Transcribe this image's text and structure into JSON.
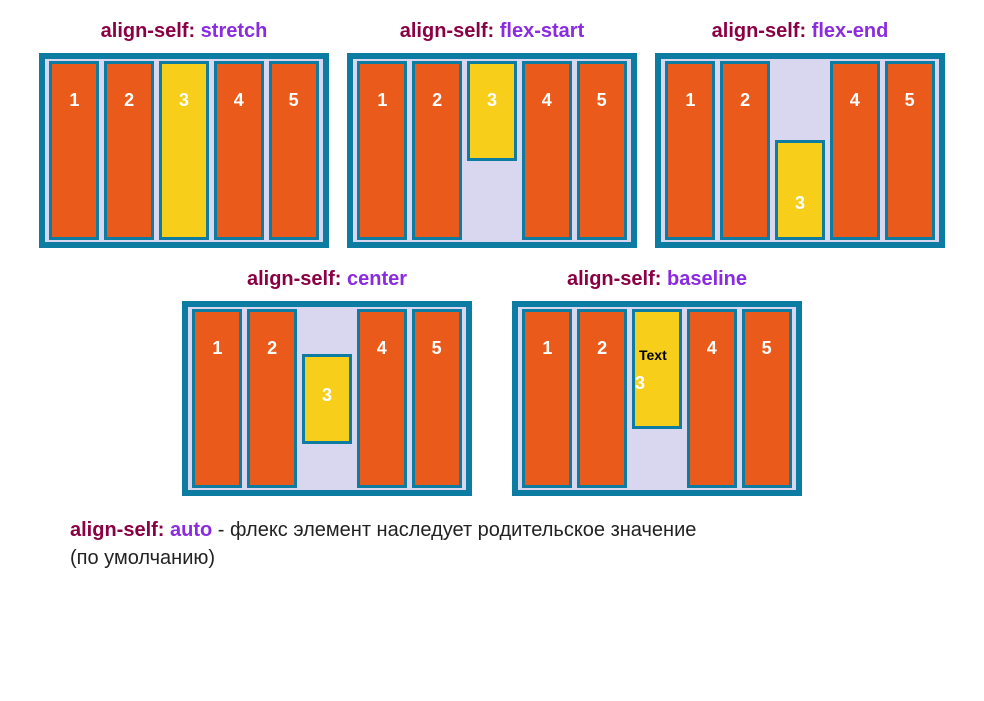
{
  "panels": [
    {
      "prop": "align-self",
      "val": "stretch",
      "mode": "stretch"
    },
    {
      "prop": "align-self",
      "val": "flex-start",
      "mode": "flex-start"
    },
    {
      "prop": "align-self",
      "val": "flex-end",
      "mode": "flex-end"
    },
    {
      "prop": "align-self",
      "val": "center",
      "mode": "center"
    },
    {
      "prop": "align-self",
      "val": "baseline",
      "mode": "baseline"
    }
  ],
  "items": [
    "1",
    "2",
    "3",
    "4",
    "5"
  ],
  "baseline_text": "Text",
  "footer": {
    "prop": "align-self",
    "val": "auto",
    "rest1": " - флекс элемент наследует родительское значение",
    "rest2": "(по умолчанию)"
  }
}
